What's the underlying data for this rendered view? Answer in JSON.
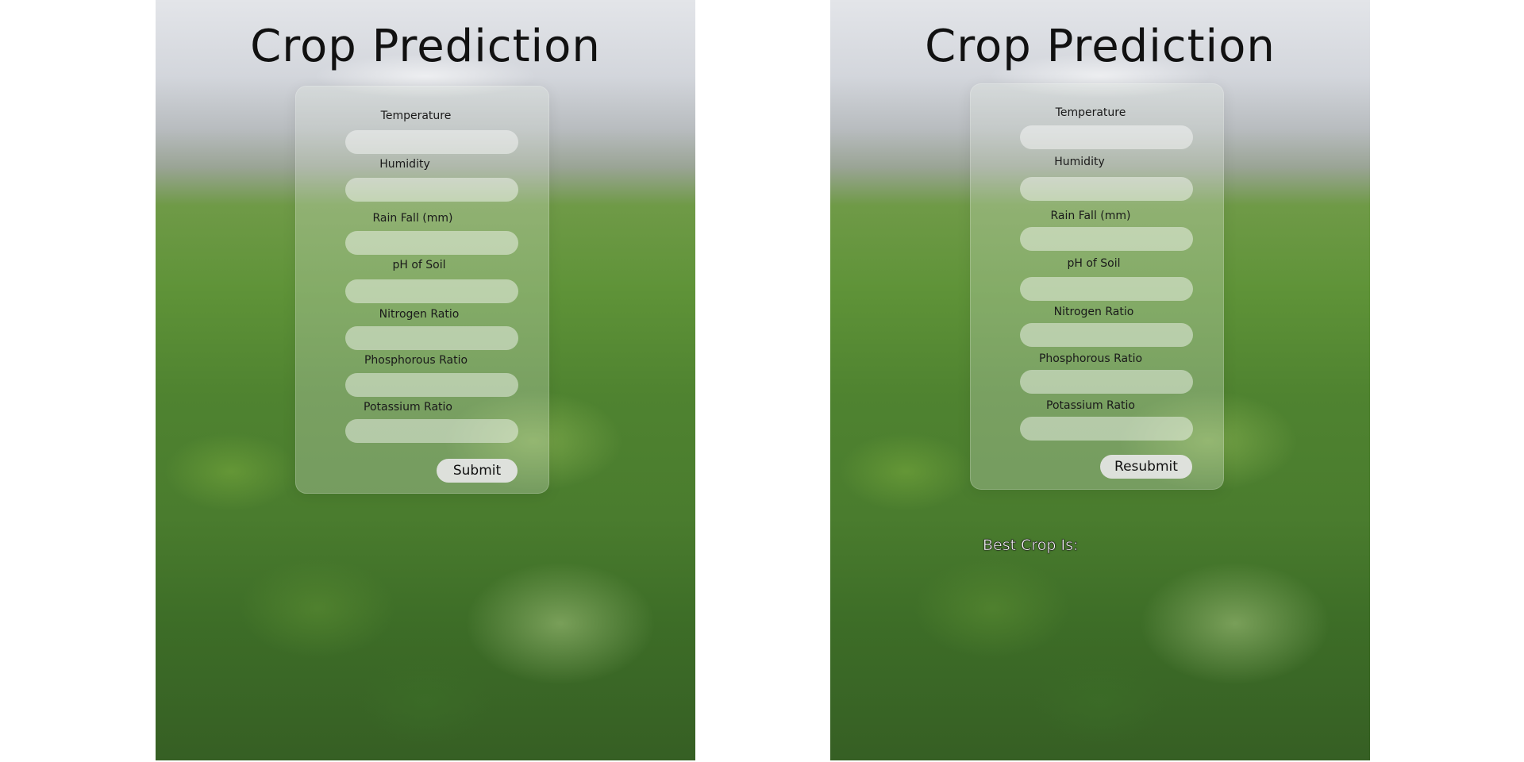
{
  "title": "Crop Prediction",
  "fields": [
    {
      "label": "Temperature",
      "value": ""
    },
    {
      "label": "Humidity",
      "value": ""
    },
    {
      "label": "Rain Fall (mm)",
      "value": ""
    },
    {
      "label": "pH of Soil",
      "value": ""
    },
    {
      "label": "Nitrogen Ratio",
      "value": ""
    },
    {
      "label": "Phosphorous Ratio",
      "value": ""
    },
    {
      "label": "Potassium Ratio",
      "value": ""
    }
  ],
  "left_screen": {
    "button_label": "Submit"
  },
  "right_screen": {
    "button_label": "Resubmit",
    "result_label": "Best Crop Is:"
  }
}
